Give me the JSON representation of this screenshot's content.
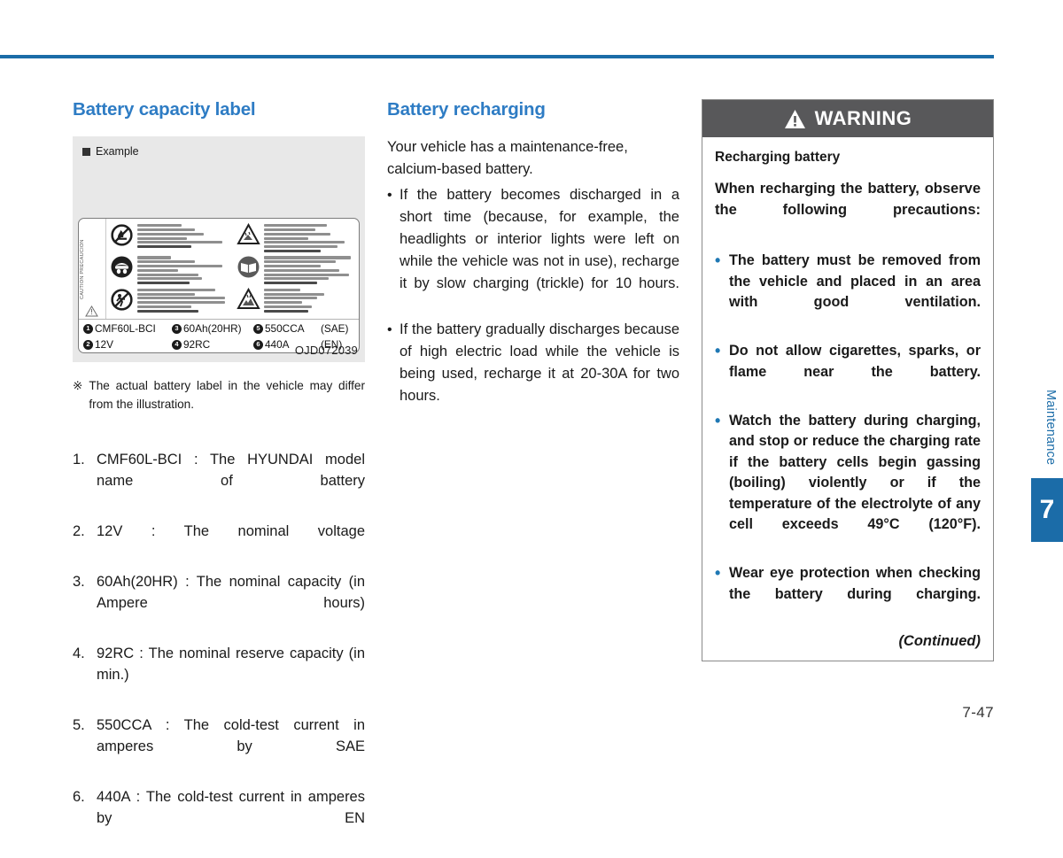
{
  "page": {
    "number": "7-47",
    "side_tab_label": "Maintenance",
    "side_tab_number": "7",
    "accent_blue": "#2e7cc4",
    "rule_blue": "#1b6ca8",
    "warning_header_gray": "#58585a",
    "bullet_blue": "#1f78b4"
  },
  "column_left": {
    "heading": "Battery capacity label",
    "figure": {
      "example_label": "Example",
      "figure_id": "OJD072039",
      "caution_side_text": "CAUTION  PRECAUCION",
      "label_specs": [
        {
          "num": "1",
          "text": "CMF60L-BCI"
        },
        {
          "num": "3",
          "text": "60Ah(20HR)"
        },
        {
          "num": "5",
          "text": "550CCA"
        },
        {
          "num": "",
          "text": "(SAE)"
        },
        {
          "num": "2",
          "text": "12V"
        },
        {
          "num": "4",
          "text": "92RC"
        },
        {
          "num": "6",
          "text": "440A"
        },
        {
          "num": "",
          "text": "(EN)"
        }
      ],
      "pictograms_left": [
        "no-flame-no-smoking-icon",
        "shield-eyes-icon",
        "keep-away-from-children-icon"
      ],
      "pictograms_right": [
        "sulfuric-acid-warning-icon",
        "read-manual-icon",
        "explosive-warning-icon"
      ]
    },
    "note_mark": "※",
    "note_text": "The actual battery label in the vehicle may differ from the illustration.",
    "numbered_list": [
      {
        "n": "1.",
        "text": "CMF60L-BCI : The HYUNDAI model name of battery"
      },
      {
        "n": "2.",
        "text": "12V : The nominal voltage"
      },
      {
        "n": "3.",
        "text": "60Ah(20HR) : The nominal capacity (in Ampere hours)"
      },
      {
        "n": "4.",
        "text": "92RC : The nominal reserve capacity (in min.)"
      },
      {
        "n": "5.",
        "text": "550CCA : The cold-test current in amperes by SAE"
      },
      {
        "n": "6.",
        "text": "440A : The cold-test current in amperes by EN"
      }
    ]
  },
  "column_middle": {
    "heading": "Battery recharging",
    "intro": "Your vehicle has a maintenance-free, calcium-based battery.",
    "bullets": [
      "If the battery becomes discharged in a short time (because, for example, the headlights or interior lights were left on while the vehicle was not in use), recharge it by slow charging (trickle) for 10 hours.",
      "If the battery gradually discharges because of high electric load while the vehicle is being used, recharge it at 20-30A for two hours."
    ]
  },
  "column_right": {
    "warning": {
      "header_title": "WARNING",
      "header_icon": "warning-triangle-icon",
      "subtitle": "Recharging battery",
      "intro": "When recharging the battery, observe the following precautions:",
      "items": [
        "The battery must be removed from the vehicle and placed in an area with good ventilation.",
        "Do not allow cigarettes, sparks, or flame near the battery.",
        "Watch the battery during charging, and stop or reduce the charging rate if the battery cells begin gassing (boiling) violently or if the temperature of the electrolyte of any cell exceeds 49°C (120°F).",
        "Wear eye protection when checking the battery during charging."
      ],
      "continued_label": "(Continued)"
    }
  }
}
